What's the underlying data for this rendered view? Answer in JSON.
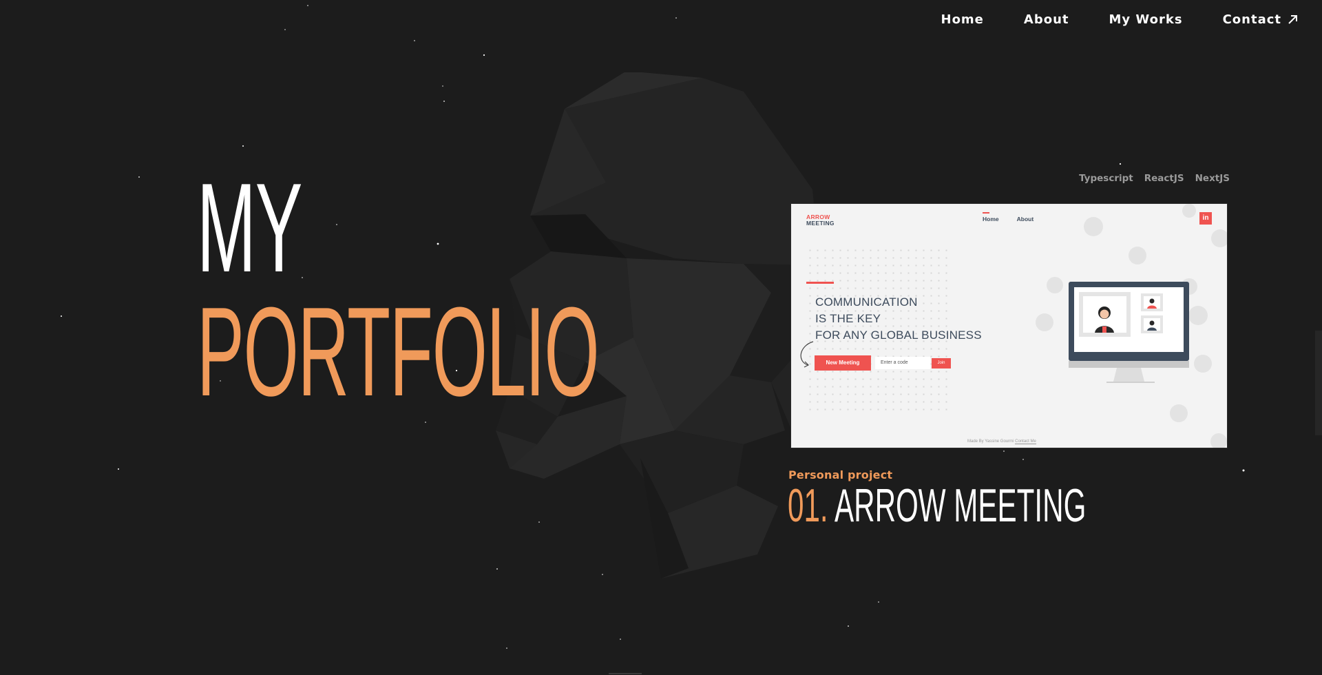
{
  "nav": {
    "items": [
      {
        "label": "Home"
      },
      {
        "label": "About"
      },
      {
        "label": "My Works"
      },
      {
        "label": "Contact",
        "icon": "arrow-up-right-icon"
      }
    ]
  },
  "hero": {
    "line1": "MY",
    "line2": "PORTFOLIO"
  },
  "project": {
    "tags": [
      "Typescript",
      "ReactJS",
      "NextJS"
    ],
    "kind": "Personal project",
    "number": "01.",
    "title": "ARROW MEETING",
    "preview": {
      "logo_line1": "ARROW",
      "logo_line2": "MEETING",
      "nav": [
        "Home",
        "About"
      ],
      "linkedin": "in",
      "heading": [
        "COMMUNICATION",
        "IS THE KEY",
        "FOR ANY GLOBAL BUSINESS"
      ],
      "new_meeting": "New Meeting",
      "code_placeholder": "Enter a code",
      "join": "Join",
      "footer_prefix": "Made By Yassine Gourmi",
      "footer_link": "Contact Me"
    }
  },
  "colors": {
    "background": "#1c1c1c",
    "accent": "#f09a5a",
    "text": "#ffffff",
    "tag": "#9a9a9a",
    "preview_red": "#ef5350",
    "preview_navy": "#3d4b5c"
  }
}
